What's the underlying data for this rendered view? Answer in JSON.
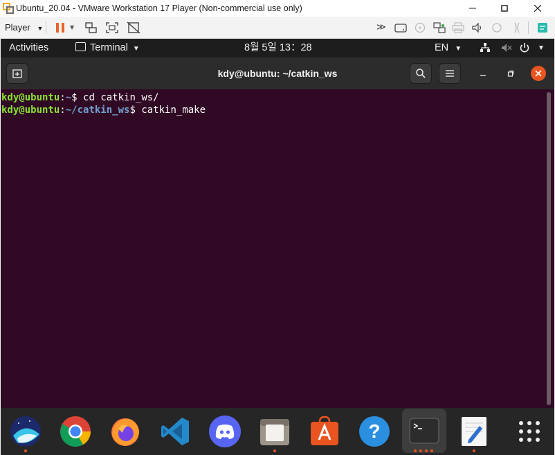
{
  "vmware": {
    "title": "Ubuntu_20.04 - VMware Workstation 17 Player (Non-commercial use only)",
    "player_label": "Player",
    "icons": [
      "pause-icon",
      "send-ctrl-alt-del-icon",
      "fullscreen-icon",
      "unity-icon",
      "hardware-icons"
    ]
  },
  "topbar": {
    "activities": "Activities",
    "app_menu": "Terminal",
    "datetime": "8월 5일  13：28",
    "lang": "EN"
  },
  "terminal": {
    "title": "kdy@ubuntu: ~/catkin_ws",
    "lines": [
      {
        "user": "kdy@ubuntu",
        "sep": ":",
        "path": "~",
        "prompt": "$ ",
        "cmd": "cd catkin_ws/"
      },
      {
        "user": "kdy@ubuntu",
        "sep": ":",
        "path": "~/catkin_ws",
        "prompt": "$ ",
        "cmd": "catkin_make"
      }
    ]
  },
  "dock": {
    "apps": [
      "naver-whale",
      "chrome",
      "firefox",
      "vscode",
      "discord",
      "files",
      "ubuntu-software",
      "help",
      "terminal",
      "text-editor",
      "show-applications"
    ]
  },
  "colors": {
    "terminal_bg": "#300a24",
    "prompt_user": "#8ae234",
    "prompt_path": "#729fcf",
    "accent": "#e95420"
  }
}
